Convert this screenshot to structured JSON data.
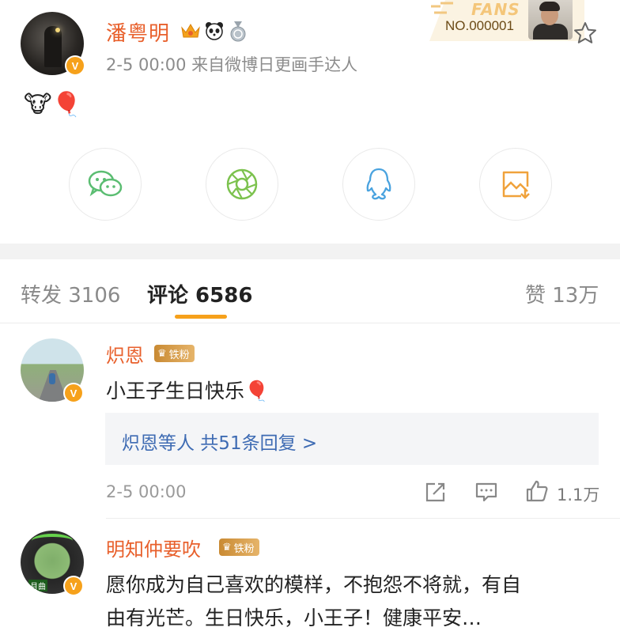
{
  "post": {
    "author": "潘粤明",
    "meta": "2-5 00:00  来自微博日更画手达人",
    "emojis": "🐮🎈",
    "fans_card": {
      "word": "FANS",
      "number": "NO.000001"
    }
  },
  "share": [
    "wechat-icon",
    "moments-icon",
    "qq-icon",
    "save-image-icon"
  ],
  "tabs": {
    "repost": "转发 3106",
    "comments": "评论 6586",
    "likes": "赞 13万"
  },
  "comments": [
    {
      "name": "炽恩",
      "badge": "铁粉",
      "text": "小王子生日快乐🎈",
      "reply_summary": "炽恩等人  共51条回复 >",
      "time": "2-5 00:00",
      "likes": "1.1万"
    },
    {
      "name": "明知仲要吹",
      "badge": "铁粉",
      "text_line1": "愿你成为自己喜欢的模样，不抱怨不将就，有自",
      "text_line2": "由有光芒。生日快乐，小王子！健康平安…"
    }
  ],
  "colors": {
    "accent_orange": "#e8602c",
    "badge_gold": "#f6a11b",
    "link_blue": "#3e6bb3"
  }
}
